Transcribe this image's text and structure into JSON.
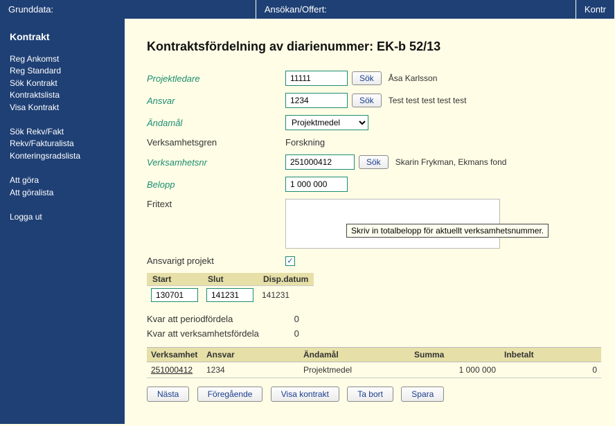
{
  "topnav": [
    "Grunddata:",
    "Ansökan/Offert:",
    "Kontr"
  ],
  "sidebar": {
    "heading": "Kontrakt",
    "groups": [
      [
        "Reg Ankomst",
        "Reg Standard",
        "Sök Kontrakt",
        "Kontraktslista",
        "Visa Kontrakt"
      ],
      [
        "Sök Rekv/Fakt",
        "Rekv/Fakturalista",
        "Konteringsradslista"
      ],
      [
        "Att göra",
        "Att göralista"
      ],
      [
        "Logga ut"
      ]
    ]
  },
  "page_title": "Kontraktsfördelning av diarienummer: EK-b 52/13",
  "form": {
    "projektledare": {
      "label": "Projektledare",
      "value": "11111",
      "sok": "Sök",
      "aux": "Åsa Karlsson"
    },
    "ansvar": {
      "label": "Ansvar",
      "value": "1234",
      "sok": "Sök",
      "aux": "Test test test test test"
    },
    "andamal": {
      "label": "Ändamål",
      "value": "Projektmedel"
    },
    "verksamhetsgren": {
      "label": "Verksamhetsgren",
      "value": "Forskning"
    },
    "verksamhetsnr": {
      "label": "Verksamhetsnr",
      "value": "251000412",
      "sok": "Sök",
      "aux": "Skarin Frykman, Ekmans fond"
    },
    "belopp": {
      "label": "Belopp",
      "value": "1 000 000"
    },
    "fritext": {
      "label": "Fritext",
      "value": ""
    },
    "ansvarigt": {
      "label": "Ansvarigt projekt",
      "checked": "✓"
    }
  },
  "tooltip": "Skriv in totalbelopp för aktuellt verksamhetsnummer.",
  "date_table": {
    "headers": [
      "Start",
      "Slut",
      "Disp.datum"
    ],
    "row": {
      "start": "130701",
      "slut": "141231",
      "disp": "141231"
    }
  },
  "kvar_period": {
    "label": "Kvar att periodfördela",
    "value": "0"
  },
  "kvar_verksamhet": {
    "label": "Kvar att verksamhetsfördela",
    "value": "0"
  },
  "dist_table": {
    "headers": [
      "Verksamhet",
      "Ansvar",
      "Ändamål",
      "Summa",
      "Inbetalt"
    ],
    "rows": [
      {
        "verksamhet": "251000412",
        "ansvar": "1234",
        "andamal": "Projektmedel",
        "summa": "1 000 000",
        "inbetalt": "0"
      }
    ]
  },
  "buttons": {
    "nasta": "Nästa",
    "foregaende": "Föregående",
    "visa_kontrakt": "Visa kontrakt",
    "ta_bort": "Ta bort",
    "spara": "Spara"
  }
}
